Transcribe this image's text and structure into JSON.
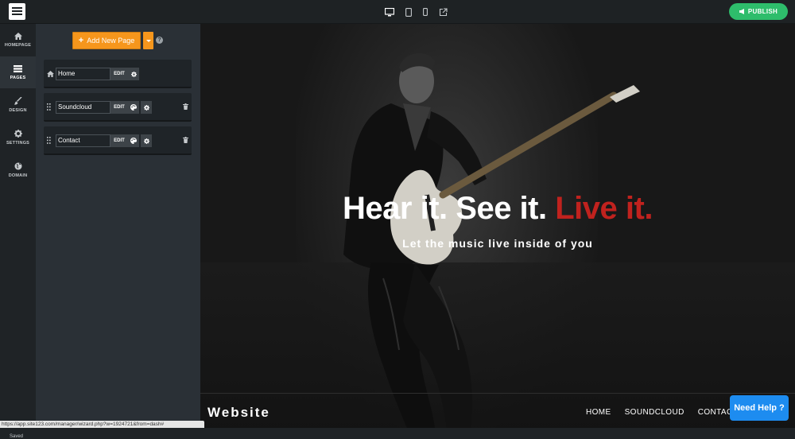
{
  "topbar": {
    "publish_label": "PUBLISH",
    "device_icons": [
      "desktop-icon",
      "tablet-icon",
      "mobile-icon",
      "external-link-icon"
    ]
  },
  "leftnav": {
    "items": [
      {
        "label": "HOMEPAGE",
        "icon": "home-icon",
        "active": false
      },
      {
        "label": "PAGES",
        "icon": "pages-icon",
        "active": true
      },
      {
        "label": "DESIGN",
        "icon": "brush-icon",
        "active": false
      },
      {
        "label": "SETTINGS",
        "icon": "gear-icon",
        "active": false
      },
      {
        "label": "DOMAIN",
        "icon": "globe-icon",
        "active": false
      }
    ],
    "saved_label": "Saved"
  },
  "pages_panel": {
    "add_label": "Add New Page",
    "edit_label": "EDIT",
    "rows": [
      {
        "name": "Home"
      },
      {
        "name": "Soundcloud"
      },
      {
        "name": "Contact"
      }
    ]
  },
  "preview": {
    "headline_main": "Hear it. See it.",
    "headline_accent": "Live it.",
    "subheadline": "Let the music live inside of you",
    "brand": "Website",
    "nav": [
      "HOME",
      "SOUNDCLOUD",
      "CONTACT"
    ]
  },
  "need_help_label": "Need Help ?",
  "status_url": "https://app.site123.com/manager/wizard.php?w=1924721&from=dash#",
  "colors": {
    "accent_orange": "#f6961c",
    "publish_green": "#2ebd6b",
    "headline_red": "#c0221e",
    "help_blue": "#1d8cf0"
  }
}
